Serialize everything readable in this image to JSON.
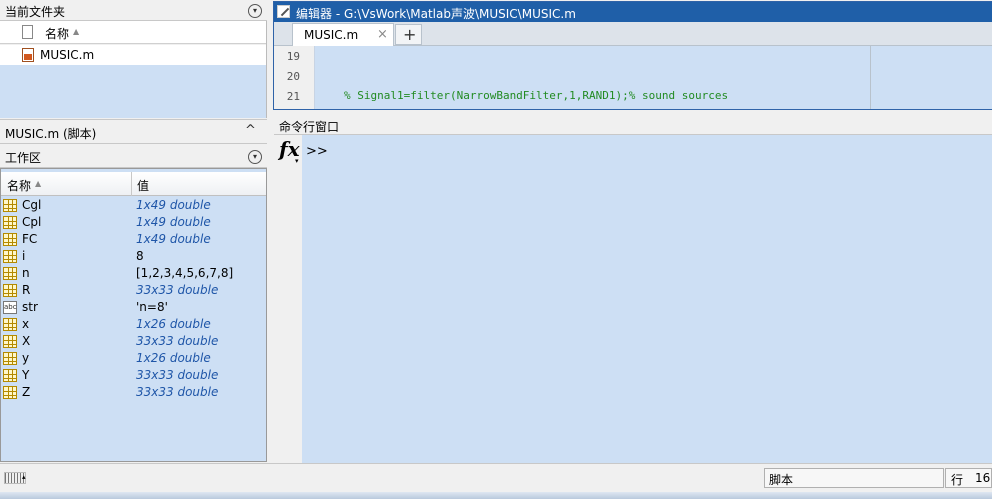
{
  "current_folder": {
    "title": "当前文件夹",
    "column_name": "名称",
    "files": [
      "MUSIC.m"
    ]
  },
  "details": {
    "label": "MUSIC.m  (脚本)"
  },
  "workspace": {
    "title": "工作区",
    "col_name": "名称",
    "col_value": "值",
    "rows": [
      {
        "name": "Cgl",
        "value": "1x49 double"
      },
      {
        "name": "Cpl",
        "value": "1x49 double"
      },
      {
        "name": "FC",
        "value": "1x49 double"
      },
      {
        "name": "i",
        "value": "8"
      },
      {
        "name": "n",
        "value": "[1,2,3,4,5,6,7,8]"
      },
      {
        "name": "R",
        "value": "33x33 double"
      },
      {
        "name": "str",
        "value": "'n=8'"
      },
      {
        "name": "x",
        "value": "1x26 double"
      },
      {
        "name": "X",
        "value": "33x33 double"
      },
      {
        "name": "y",
        "value": "1x26 double"
      },
      {
        "name": "Y",
        "value": "33x33 double"
      },
      {
        "name": "Z",
        "value": "33x33 double"
      }
    ]
  },
  "editor": {
    "title": "编辑器 - G:\\VsWork\\Matlab声波\\MUSIC\\MUSIC.m",
    "tab_label": "MUSIC.m",
    "tab_close": "×",
    "add_tab": "+",
    "lines": [
      {
        "no": "19",
        "code": ""
      },
      {
        "no": "20",
        "code": ""
      },
      {
        "no": "21",
        "code": "% Signal1=filter(NarrowBandFilter,1,RAND1);% sound sources"
      }
    ]
  },
  "command_window": {
    "title": "命令行窗口",
    "fx": "fx",
    "prompt": ">>"
  },
  "status_bar": {
    "mode": "脚本",
    "row_label": "行",
    "row_value": "16"
  }
}
